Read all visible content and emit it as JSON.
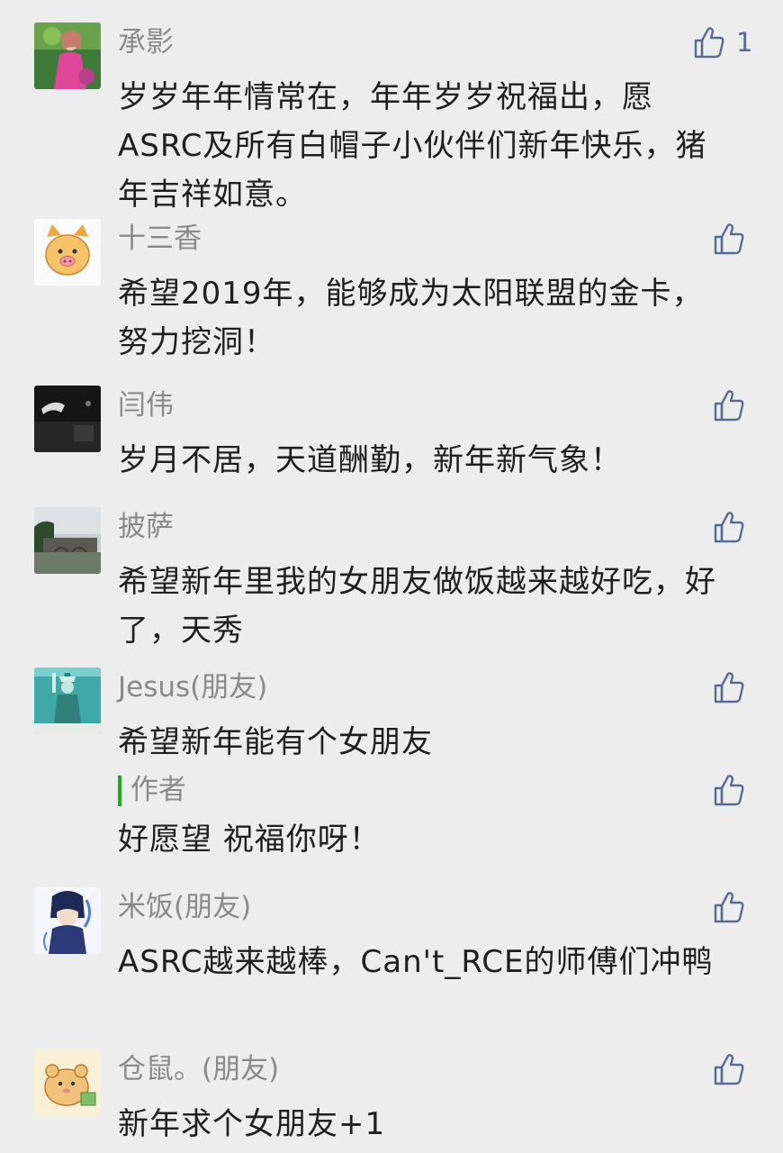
{
  "comments": [
    {
      "name": "承影",
      "text": "岁岁年年情常在，年年岁岁祝福出，愿ASRC及所有白帽子小伙伴们新年快乐，猪年吉祥如意。",
      "like_count": "1",
      "avatar": "photo-woman-pink-dress"
    },
    {
      "name": "十三香",
      "text": "希望2019年，能够成为太阳联盟的金卡，努力挖洞！",
      "avatar": "cartoon-pig"
    },
    {
      "name": "闫伟",
      "text": "岁月不居，天道酬勤，新年新气象！",
      "avatar": "dark-night-photo"
    },
    {
      "name": "披萨",
      "text": "希望新年里我的女朋友做饭越来越好吃，好了，天秀",
      "avatar": "landscape-photo"
    },
    {
      "name": "Jesus(朋友)",
      "text": "希望新年能有个女朋友",
      "avatar": "statue-of-liberty-art",
      "author_reply": {
        "label": "作者",
        "text": "好愿望 祝福你呀！"
      }
    },
    {
      "name": "米饭(朋友)",
      "text": "ASRC越来越棒，Can't_RCE的师傅们冲鸭",
      "avatar": "anime-character"
    },
    {
      "name": "仓鼠。(朋友)",
      "text": "新年求个女朋友+1",
      "avatar": "hamster-cartoon"
    }
  ],
  "colors": {
    "background": "#ededed",
    "name": "#8a8a8a",
    "text": "#1f1f1f",
    "like": "#576b95",
    "author_bar": "#1aad19"
  },
  "icons": {
    "like": "thumbs-up-icon"
  }
}
